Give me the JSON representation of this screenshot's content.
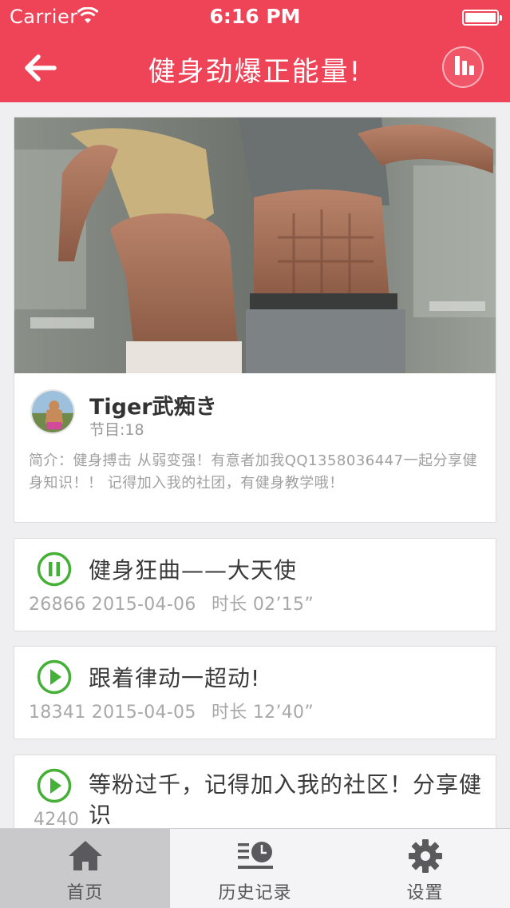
{
  "status_bar": {
    "carrier": "Carrier",
    "time": "6:16 PM"
  },
  "nav": {
    "title": "健身劲爆正能量!",
    "back_icon": "arrow-left-icon",
    "playing_icon": "equalizer-icon"
  },
  "profile": {
    "author": "Tiger武痴き",
    "episodes": "节目:18",
    "intro": "简介：健身搏击 从弱变强！有意者加我QQ1358036447一起分享健身知识！！ 记得加入我的社团，有健身教学哦！"
  },
  "episodes": [
    {
      "title": "健身狂曲——大天使",
      "plays": "26866",
      "date": "2015-04-06",
      "duration": "时长 02’15”",
      "state": "pause-icon"
    },
    {
      "title": "跟着律动一超动!",
      "plays": "18341",
      "date": "2015-04-05",
      "duration": "时长 12’40”",
      "state": "play-icon"
    },
    {
      "title": "等粉过千，记得加入我的社区！分享健识",
      "plays": "4240",
      "date": "",
      "duration": "",
      "state": "play-icon"
    }
  ],
  "tabs": [
    {
      "label": "首页",
      "icon": "home-icon",
      "active": true
    },
    {
      "label": "历史记录",
      "icon": "history-icon",
      "active": false
    },
    {
      "label": "设置",
      "icon": "gear-icon",
      "active": false
    }
  ],
  "colors": {
    "brand_red": "#ef4357",
    "play_green": "#44b035",
    "background": "#efeff2"
  }
}
